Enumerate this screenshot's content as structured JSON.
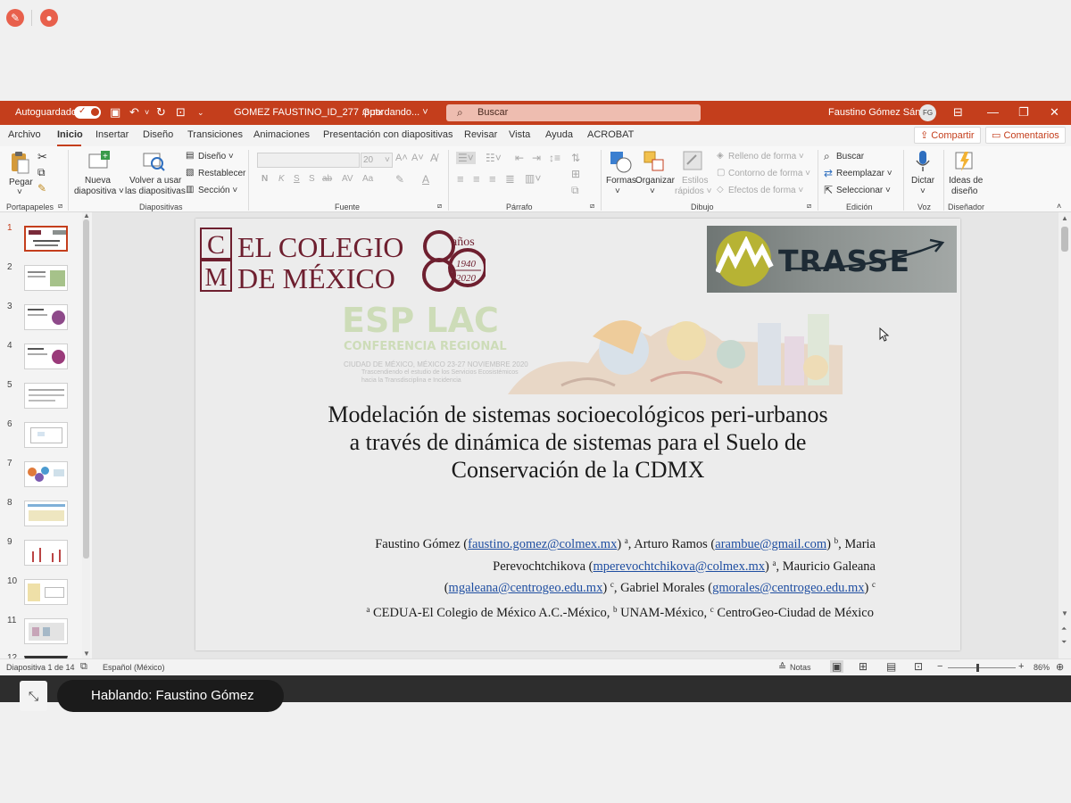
{
  "meeting": {
    "top_left_icons": [
      "pen-icon",
      "record-icon"
    ],
    "speaking_label": "Hablando: Faustino Gómez"
  },
  "titlebar": {
    "autosave_label": "Autoguardado",
    "file_name": "GOMEZ FAUSTINO_ID_277 .pptx",
    "save_status": "Guardando... ˅",
    "search_placeholder": "Buscar",
    "user_name": "Faustino Gómez Sántiz",
    "user_initials": "FG",
    "accent_color": "#c43e1c"
  },
  "tabs": {
    "items": [
      "Archivo",
      "Inicio",
      "Insertar",
      "Diseño",
      "Transiciones",
      "Animaciones",
      "Presentación con diapositivas",
      "Revisar",
      "Vista",
      "Ayuda",
      "ACROBAT"
    ],
    "active": "Inicio",
    "share_label": "Compartir",
    "comments_label": "Comentarios"
  },
  "ribbon": {
    "portapapeles": {
      "paste": "Pegar",
      "label": "Portapapeles"
    },
    "diapositivas": {
      "new_slide_1": "Nueva",
      "new_slide_2": "diapositiva ˅",
      "reuse_1": "Volver a usar",
      "reuse_2": "las diapositivas",
      "design": "Diseño ˅",
      "reset": "Restablecer",
      "section": "Sección ˅",
      "label": "Diapositivas"
    },
    "fuente": {
      "size": "20",
      "label": "Fuente"
    },
    "parrafo": {
      "label": "Párrafo"
    },
    "dibujo": {
      "shapes": "Formas",
      "arrange": "Organizar",
      "styles_1": "Estilos",
      "styles_2": "rápidos ˅",
      "fill": "Relleno de forma ˅",
      "outline": "Contorno de forma ˅",
      "effects": "Efectos de forma ˅",
      "label": "Dibujo"
    },
    "edicion": {
      "find": "Buscar",
      "replace": "Reemplazar ˅",
      "select": "Seleccionar ˅",
      "label": "Edición"
    },
    "voz": {
      "dictate": "Dictar",
      "label": "Voz"
    },
    "disenador": {
      "ideas_1": "Ideas de",
      "ideas_2": "diseño",
      "label": "Diseñador"
    }
  },
  "thumbnails": {
    "numbers": [
      "1",
      "2",
      "3",
      "4",
      "5",
      "6",
      "7",
      "8",
      "9",
      "10",
      "11",
      "12"
    ],
    "selected": "1"
  },
  "slide": {
    "colmex": {
      "letter_c": "C",
      "letter_m": "M",
      "line1": "EL COLEGIO",
      "line2": "DE MÉXICO",
      "anos": "años",
      "year1": "1940",
      "year2": "2020"
    },
    "trasse": "TRASSE",
    "banner": {
      "esp": "ESP LAC",
      "conf": "CONFERENCIA REGIONAL",
      "sub1": "CIUDAD DE MÉXICO, MÉXICO 23-27 NOVIEMBRE 2020",
      "sub2": "Trascendiendo el estudio de los Servicios Ecosistémicos hacia la Transdisciplina e Incidencia"
    },
    "title_lines": [
      "Modelación de sistemas socioecológicos peri-urbanos",
      "a través de dinámica de sistemas para el Suelo de",
      "Conservación de la CDMX"
    ],
    "authors": {
      "a1_name": "Faustino Gómez (",
      "a1_email": "faustino.gomez@colmex.mx",
      "a1_sup": "a",
      "a2_name": ", Arturo Ramos (",
      "a2_email": "arambue@gmail.com",
      "a2_sup": "b",
      "a3_name_1": ", Maria",
      "a3_name_2": "Perevochtchikova (",
      "a3_email": "mperevochtchikova@colmex.mx",
      "a3_sup": "a",
      "a4_name": ", Mauricio Galeana",
      "a4_email": "mgaleana@centrogeo.edu.mx",
      "a4_sup": "c",
      "a5_name": ", Gabriel Morales (",
      "a5_email": "gmorales@centrogeo.edu.mx",
      "a5_sup": "c"
    },
    "affiliations": {
      "a_sup": "a",
      "a_text": " CEDUA-El Colegio de México A.C.-México, ",
      "b_sup": "b",
      "b_text": " UNAM-México, ",
      "c_sup": "c",
      "c_text": " CentroGeo-Ciudad de México"
    }
  },
  "statusbar": {
    "slide_info": "Diapositiva 1 de 14",
    "language": "Español (México)",
    "notes": "Notas",
    "zoom": "86%"
  }
}
